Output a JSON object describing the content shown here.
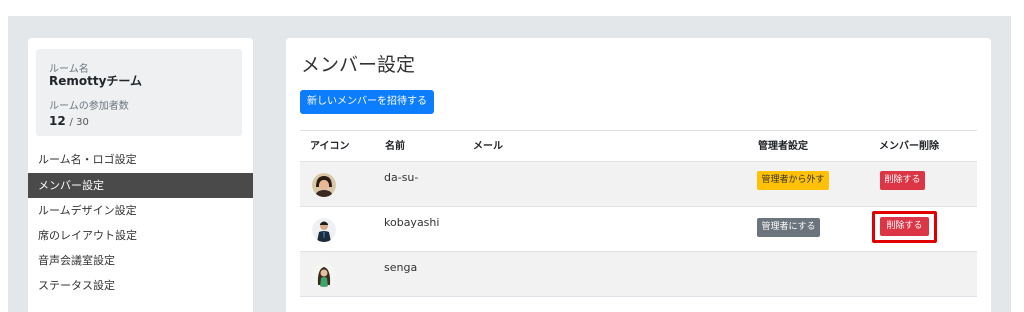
{
  "sidebar": {
    "room_label": "ルーム名",
    "room_name": "Remottyチーム",
    "participants_label": "ルームの参加者数",
    "participants_current": "12",
    "participants_max": "/ 30",
    "menu": [
      {
        "label": "ルーム名・ロゴ設定",
        "active": false
      },
      {
        "label": "メンバー設定",
        "active": true
      },
      {
        "label": "ルームデザイン設定",
        "active": false
      },
      {
        "label": "席のレイアウト設定",
        "active": false
      },
      {
        "label": "音声会議室設定",
        "active": false
      },
      {
        "label": "ステータス設定",
        "active": false
      }
    ]
  },
  "main": {
    "title": "メンバー設定",
    "invite_button": "新しいメンバーを招待する",
    "columns": {
      "icon": "アイコン",
      "name": "名前",
      "mail": "メール",
      "admin": "管理者設定",
      "delete": "メンバー削除"
    },
    "rows": [
      {
        "name": "da-su-",
        "admin_action": "管理者から外す",
        "admin_style": "warning",
        "delete_action": "削除する"
      },
      {
        "name": "kobayashi",
        "admin_action": "管理者にする",
        "admin_style": "secondary",
        "delete_action": "削除する",
        "highlighted": true
      },
      {
        "name": "senga",
        "admin_action": "",
        "delete_action": ""
      }
    ]
  },
  "colors": {
    "primary": "#0d7dff",
    "warning": "#ffc107",
    "secondary": "#6c757d",
    "danger": "#dc3545",
    "highlight": "#e00000",
    "active_menu": "#4a4a4a"
  },
  "icons": {
    "avatar_1": "avatar-woman-icon",
    "avatar_2": "avatar-man-suit-icon",
    "avatar_3": "avatar-woman-green-icon"
  }
}
